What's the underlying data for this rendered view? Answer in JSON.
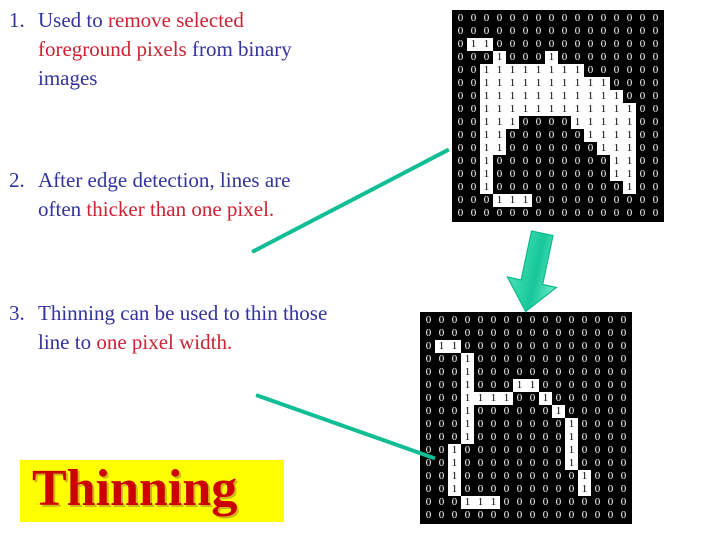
{
  "slide": {
    "title_banner": {
      "text": "Thinning",
      "bg_color": "#FFFF00",
      "text_color": "#CC0000"
    },
    "text_colors": {
      "primary": "#333399",
      "highlight": "#CC2233",
      "accent_green": "#11BE93"
    }
  },
  "bullets": [
    {
      "number": "1.",
      "segments": [
        {
          "text": "Used to ",
          "highlight": false
        },
        {
          "text": "remove selected foreground pixels",
          "highlight": true
        },
        {
          "text": " from binary images",
          "highlight": false
        }
      ]
    },
    {
      "number": "2.",
      "segments": [
        {
          "text": "After edge detection, lines are often ",
          "highlight": false
        },
        {
          "text": "thicker than one pixel.",
          "highlight": true
        }
      ]
    },
    {
      "number": "3.",
      "segments": [
        {
          "text": "Thinning can be used to thin those line to ",
          "highlight": false
        },
        {
          "text": "one pixel width.",
          "highlight": true
        }
      ]
    }
  ],
  "grids": {
    "top": {
      "label": "thick-binary-image",
      "rows": 16,
      "cols": 16,
      "matrix": [
        [
          0,
          0,
          0,
          0,
          0,
          0,
          0,
          0,
          0,
          0,
          0,
          0,
          0,
          0,
          0,
          0
        ],
        [
          0,
          0,
          0,
          0,
          0,
          0,
          0,
          0,
          0,
          0,
          0,
          0,
          0,
          0,
          0,
          0
        ],
        [
          0,
          1,
          1,
          0,
          0,
          0,
          0,
          0,
          0,
          0,
          0,
          0,
          0,
          0,
          0,
          0
        ],
        [
          0,
          0,
          0,
          1,
          0,
          0,
          0,
          1,
          0,
          0,
          0,
          0,
          0,
          0,
          0,
          0
        ],
        [
          0,
          0,
          1,
          1,
          1,
          1,
          1,
          1,
          1,
          1,
          0,
          0,
          0,
          0,
          0,
          0
        ],
        [
          0,
          0,
          1,
          1,
          1,
          1,
          1,
          1,
          1,
          1,
          1,
          1,
          0,
          0,
          0,
          0
        ],
        [
          0,
          0,
          1,
          1,
          1,
          1,
          1,
          1,
          1,
          1,
          1,
          1,
          1,
          0,
          0,
          0
        ],
        [
          0,
          0,
          1,
          1,
          1,
          1,
          1,
          1,
          1,
          1,
          1,
          1,
          1,
          1,
          0,
          0
        ],
        [
          0,
          0,
          1,
          1,
          1,
          0,
          0,
          0,
          0,
          1,
          1,
          1,
          1,
          1,
          0,
          0
        ],
        [
          0,
          0,
          1,
          1,
          0,
          0,
          0,
          0,
          0,
          0,
          1,
          1,
          1,
          1,
          0,
          0
        ],
        [
          0,
          0,
          1,
          1,
          0,
          0,
          0,
          0,
          0,
          0,
          0,
          1,
          1,
          1,
          0,
          0
        ],
        [
          0,
          0,
          1,
          0,
          0,
          0,
          0,
          0,
          0,
          0,
          0,
          0,
          1,
          1,
          0,
          0
        ],
        [
          0,
          0,
          1,
          0,
          0,
          0,
          0,
          0,
          0,
          0,
          0,
          0,
          1,
          1,
          0,
          0
        ],
        [
          0,
          0,
          1,
          0,
          0,
          0,
          0,
          0,
          0,
          0,
          0,
          0,
          0,
          1,
          0,
          0
        ],
        [
          0,
          0,
          0,
          1,
          1,
          1,
          0,
          0,
          0,
          0,
          0,
          0,
          0,
          0,
          0,
          0
        ],
        [
          0,
          0,
          0,
          0,
          0,
          0,
          0,
          0,
          0,
          0,
          0,
          0,
          0,
          0,
          0,
          0
        ]
      ]
    },
    "bottom": {
      "label": "thinned-binary-image",
      "rows": 16,
      "cols": 16,
      "matrix": [
        [
          0,
          0,
          0,
          0,
          0,
          0,
          0,
          0,
          0,
          0,
          0,
          0,
          0,
          0,
          0,
          0
        ],
        [
          0,
          0,
          0,
          0,
          0,
          0,
          0,
          0,
          0,
          0,
          0,
          0,
          0,
          0,
          0,
          0
        ],
        [
          0,
          1,
          1,
          0,
          0,
          0,
          0,
          0,
          0,
          0,
          0,
          0,
          0,
          0,
          0,
          0
        ],
        [
          0,
          0,
          0,
          1,
          0,
          0,
          0,
          0,
          0,
          0,
          0,
          0,
          0,
          0,
          0,
          0
        ],
        [
          0,
          0,
          0,
          1,
          0,
          0,
          0,
          0,
          0,
          0,
          0,
          0,
          0,
          0,
          0,
          0
        ],
        [
          0,
          0,
          0,
          1,
          0,
          0,
          0,
          1,
          1,
          0,
          0,
          0,
          0,
          0,
          0,
          0
        ],
        [
          0,
          0,
          0,
          1,
          1,
          1,
          1,
          0,
          0,
          1,
          0,
          0,
          0,
          0,
          0,
          0
        ],
        [
          0,
          0,
          0,
          1,
          0,
          0,
          0,
          0,
          0,
          0,
          1,
          0,
          0,
          0,
          0,
          0
        ],
        [
          0,
          0,
          0,
          1,
          0,
          0,
          0,
          0,
          0,
          0,
          0,
          1,
          0,
          0,
          0,
          0
        ],
        [
          0,
          0,
          0,
          1,
          0,
          0,
          0,
          0,
          0,
          0,
          0,
          1,
          0,
          0,
          0,
          0
        ],
        [
          0,
          0,
          1,
          0,
          0,
          0,
          0,
          0,
          0,
          0,
          0,
          1,
          0,
          0,
          0,
          0
        ],
        [
          0,
          0,
          1,
          0,
          0,
          0,
          0,
          0,
          0,
          0,
          0,
          1,
          0,
          0,
          0,
          0
        ],
        [
          0,
          0,
          1,
          0,
          0,
          0,
          0,
          0,
          0,
          0,
          0,
          0,
          1,
          0,
          0,
          0
        ],
        [
          0,
          0,
          1,
          0,
          0,
          0,
          0,
          0,
          0,
          0,
          0,
          0,
          1,
          0,
          0,
          0
        ],
        [
          0,
          0,
          0,
          1,
          1,
          1,
          0,
          0,
          0,
          0,
          0,
          0,
          0,
          0,
          0,
          0
        ],
        [
          0,
          0,
          0,
          0,
          0,
          0,
          0,
          0,
          0,
          0,
          0,
          0,
          0,
          0,
          0,
          0
        ]
      ]
    },
    "cell_labels": {
      "zero": "0",
      "one": "1"
    }
  },
  "connectors": [
    {
      "name": "pointer-to-thick-image",
      "color": "#11BE93"
    },
    {
      "name": "pointer-to-thin-image",
      "color": "#11BE93"
    },
    {
      "name": "thinning-process-arrow",
      "color": "#11BE93"
    }
  ]
}
